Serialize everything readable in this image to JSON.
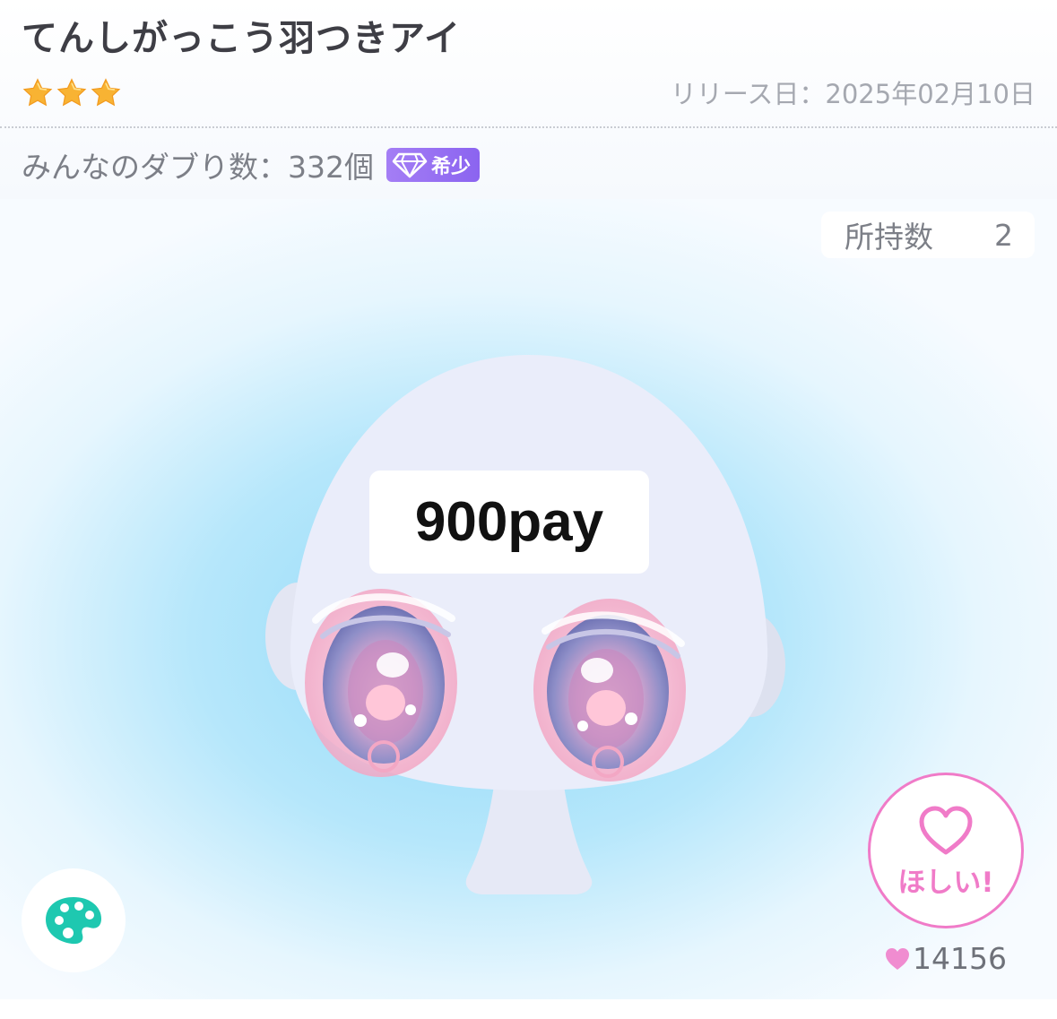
{
  "item": {
    "title": "てんしがっこう羽つきアイ",
    "rarity_stars": 3,
    "release_label": "リリース日：2025年02月10日"
  },
  "duplicates": {
    "text": "みんなのダブり数：332個",
    "badge_label": "希少"
  },
  "owned": {
    "label": "所持数",
    "count": "2"
  },
  "overlay": {
    "price_text": "900pay"
  },
  "wish": {
    "label": "ほしい!",
    "count": "14156"
  },
  "colors": {
    "title": "#3e3e45",
    "star": "#f8b333",
    "badge": "#8b64f0",
    "wish_pink": "#f07bc8",
    "palette_teal": "#1ec8b0",
    "face": "#eaedfa"
  },
  "icons": {
    "rarity": "star-icon",
    "badge": "gem-icon",
    "palette": "palette-icon",
    "wish": "heart-outline-icon",
    "likes": "heart-icon"
  }
}
